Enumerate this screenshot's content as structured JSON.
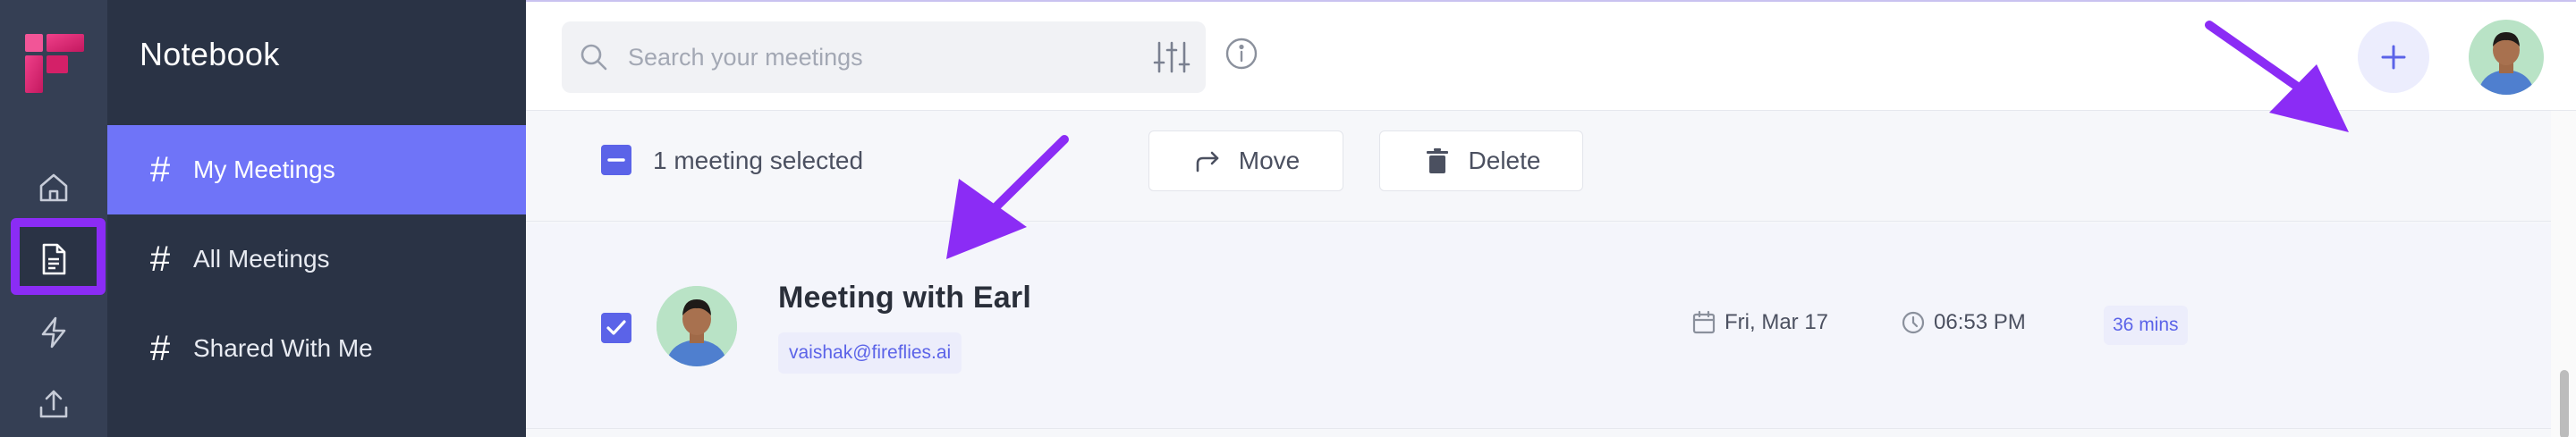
{
  "sidebar": {
    "title": "Notebook",
    "items": [
      {
        "label": "My Meetings",
        "icon": "hash-icon",
        "active": true
      },
      {
        "label": "All Meetings",
        "icon": "hash-icon",
        "active": false
      },
      {
        "label": "Shared With Me",
        "icon": "hash-icon",
        "active": false
      }
    ]
  },
  "rail": {
    "icons": [
      "logo-icon",
      "home-icon",
      "notebook-icon",
      "bolt-icon",
      "upload-icon"
    ]
  },
  "search": {
    "placeholder": "Search your meetings",
    "value": ""
  },
  "selection": {
    "text": "1 meeting selected",
    "move_label": "Move",
    "delete_label": "Delete"
  },
  "meeting": {
    "title": "Meeting with Earl",
    "email": "vaishak@fireflies.ai",
    "date": "Fri, Mar 17",
    "time": "06:53 PM",
    "duration": "36 mins"
  },
  "colors": {
    "accent": "#6f74f8",
    "highlight": "#8b2cf5",
    "brand": "#e7336a",
    "sidebar_bg": "#2a3345",
    "rail_bg": "#353f54"
  }
}
